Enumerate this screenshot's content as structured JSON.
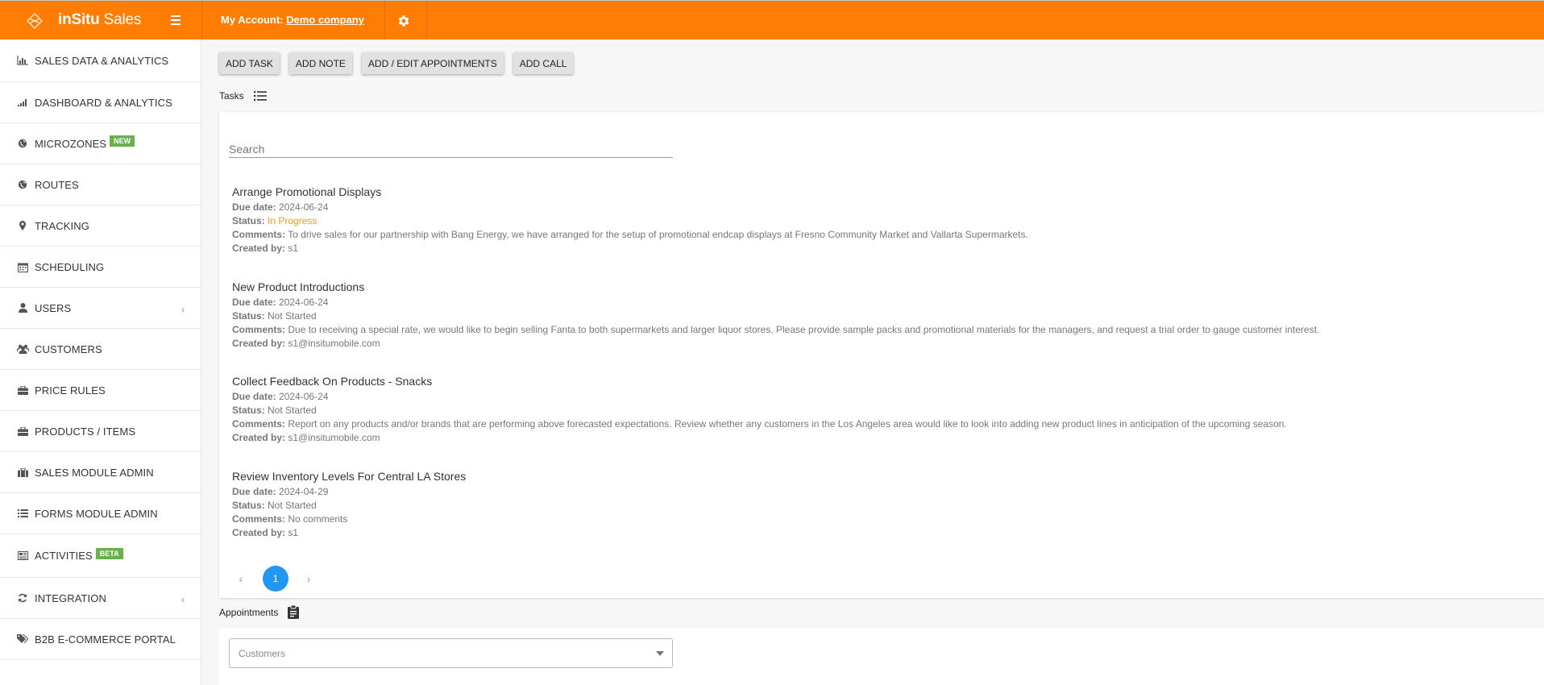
{
  "header": {
    "brand_bold": "inSitu",
    "brand_rest": " Sales",
    "account_label": "My Account:",
    "account_name": "Demo company",
    "colors": {
      "topbar": "#ff7d03"
    }
  },
  "sidebar": {
    "items": [
      {
        "label": "SALES DATA & ANALYTICS",
        "icon": "bar-chart-icon"
      },
      {
        "label": "DASHBOARD & ANALYTICS",
        "icon": "signal-bars-icon"
      },
      {
        "label": "MICROZONES",
        "icon": "globe-icon",
        "badge": "NEW"
      },
      {
        "label": "ROUTES",
        "icon": "globe-icon"
      },
      {
        "label": "TRACKING",
        "icon": "map-pin-icon"
      },
      {
        "label": "SCHEDULING",
        "icon": "calendar-icon"
      },
      {
        "label": "USERS",
        "icon": "user-icon",
        "chevron": "‹"
      },
      {
        "label": "CUSTOMERS",
        "icon": "users-icon"
      },
      {
        "label": "PRICE RULES",
        "icon": "briefcase-icon"
      },
      {
        "label": "PRODUCTS / ITEMS",
        "icon": "briefcase-icon"
      },
      {
        "label": "SALES MODULE ADMIN",
        "icon": "suitcase-icon"
      },
      {
        "label": "FORMS MODULE ADMIN",
        "icon": "list-icon"
      },
      {
        "label": "ACTIVITIES",
        "icon": "newspaper-icon",
        "badge": "BETA"
      },
      {
        "label": "INTEGRATION",
        "icon": "refresh-icon",
        "chevron": "‹"
      },
      {
        "label": "B2B E-COMMERCE PORTAL",
        "icon": "tags-icon"
      }
    ]
  },
  "actions": {
    "add_task": "ADD TASK",
    "add_note": "ADD NOTE",
    "add_edit_appointments": "ADD / EDIT APPOINTMENTS",
    "add_call": "ADD CALL"
  },
  "tasks": {
    "title": "Tasks",
    "search_placeholder": "Search",
    "labels": {
      "due": "Due date:",
      "status": "Status:",
      "comments": "Comments:",
      "created_by": "Created by:"
    },
    "items": [
      {
        "title": "Arrange Promotional Displays",
        "due": "2024-06-24",
        "status": "In Progress",
        "comments": "To drive sales for our partnership with Bang Energy, we have arranged for the setup of promotional endcap displays at Fresno Community Market and Vallarta Supermarkets.",
        "created_by": "s1"
      },
      {
        "title": "New Product Introductions",
        "due": "2024-06-24",
        "status": "Not Started",
        "comments": "Due to receiving a special rate, we would like to begin selling Fanta to both supermarkets and larger liquor stores. Please provide sample packs and promotional materials for the managers, and request a trial order to gauge customer interest.",
        "created_by": "s1@insitumobile.com"
      },
      {
        "title": "Collect Feedback On Products - Snacks",
        "due": "2024-06-24",
        "status": "Not Started",
        "comments": "Report on any products and/or brands that are performing above forecasted expectations. Review whether any customers in the Los Angeles area would like to look into adding new product lines in anticipation of the upcoming season.",
        "created_by": "s1@insitumobile.com"
      },
      {
        "title": "Review Inventory Levels For Central LA Stores",
        "due": "2024-04-29",
        "status": "Not Started",
        "comments": "No comments",
        "created_by": "s1"
      }
    ],
    "pagination": {
      "prev": "‹",
      "current": "1",
      "next": "›"
    }
  },
  "appointments": {
    "title": "Appointments",
    "customers_placeholder": "Customers"
  }
}
